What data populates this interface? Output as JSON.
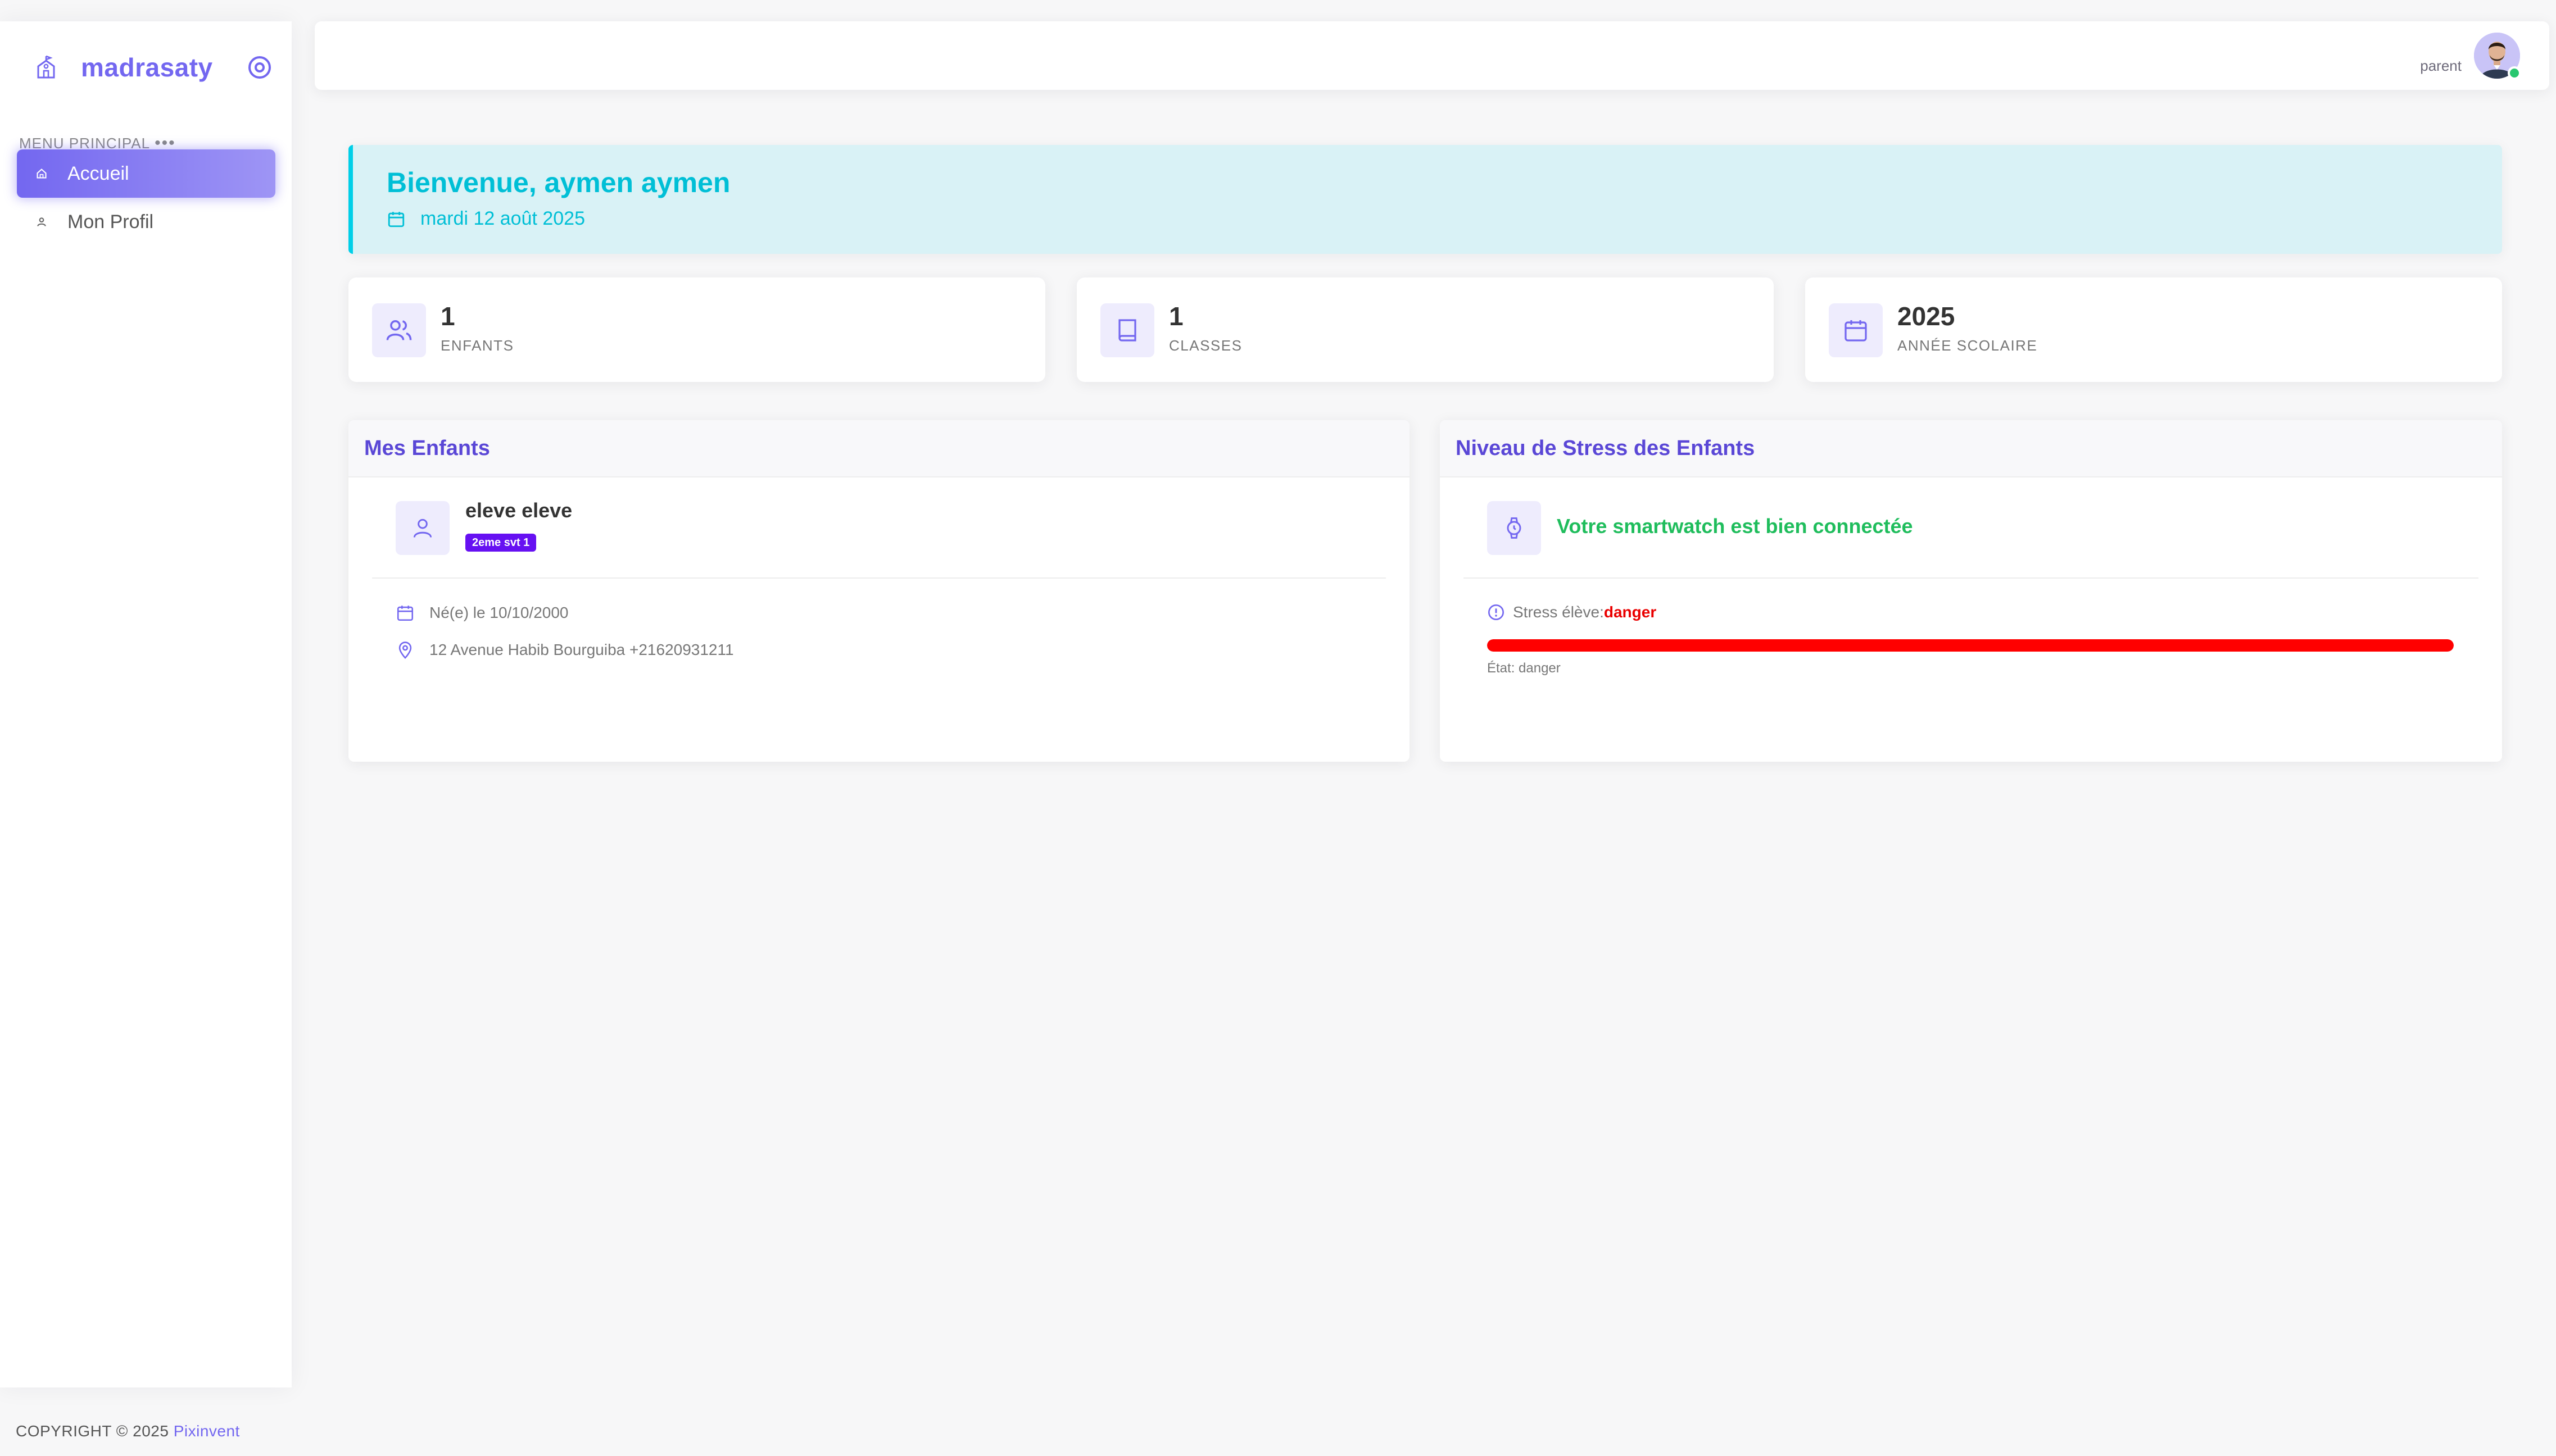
{
  "app": {
    "brand": "madrasaty"
  },
  "sidebar": {
    "menu_header": "MENU PRINCIPAL",
    "items": [
      {
        "label": "Accueil",
        "icon": "home-icon",
        "active": true
      },
      {
        "label": "Mon Profil",
        "icon": "user-icon",
        "active": false
      }
    ]
  },
  "navbar": {
    "user_role": "parent"
  },
  "welcome": {
    "title": "Bienvenue, aymen aymen",
    "date": "mardi 12 août 2025"
  },
  "stats": [
    {
      "value": "1",
      "label": "ENFANTS",
      "icon": "users-icon"
    },
    {
      "value": "1",
      "label": "CLASSES",
      "icon": "book-icon"
    },
    {
      "value": "2025",
      "label": "ANNÉE SCOLAIRE",
      "icon": "calendar-icon"
    }
  ],
  "children_panel": {
    "title": "Mes Enfants",
    "child": {
      "name": "eleve eleve",
      "class_badge": "2eme svt 1",
      "birth": "Né(e) le 10/10/2000",
      "address": "12 Avenue Habib Bourguiba +21620931211"
    }
  },
  "stress_panel": {
    "title": "Niveau de Stress des Enfants",
    "watch_status": "Votre smartwatch est bien connectée",
    "stress_label": "Stress élève:",
    "stress_value": "danger",
    "state_text": "État: danger",
    "level_fraction": 1.0
  },
  "footer": {
    "copyright": "COPYRIGHT © 2025 ",
    "company": "Pixinvent"
  },
  "colors": {
    "accent": "#7367f0",
    "info": "#00cfe8",
    "success": "#28c76f",
    "danger": "#ff0000",
    "badge": "#6610f2"
  }
}
